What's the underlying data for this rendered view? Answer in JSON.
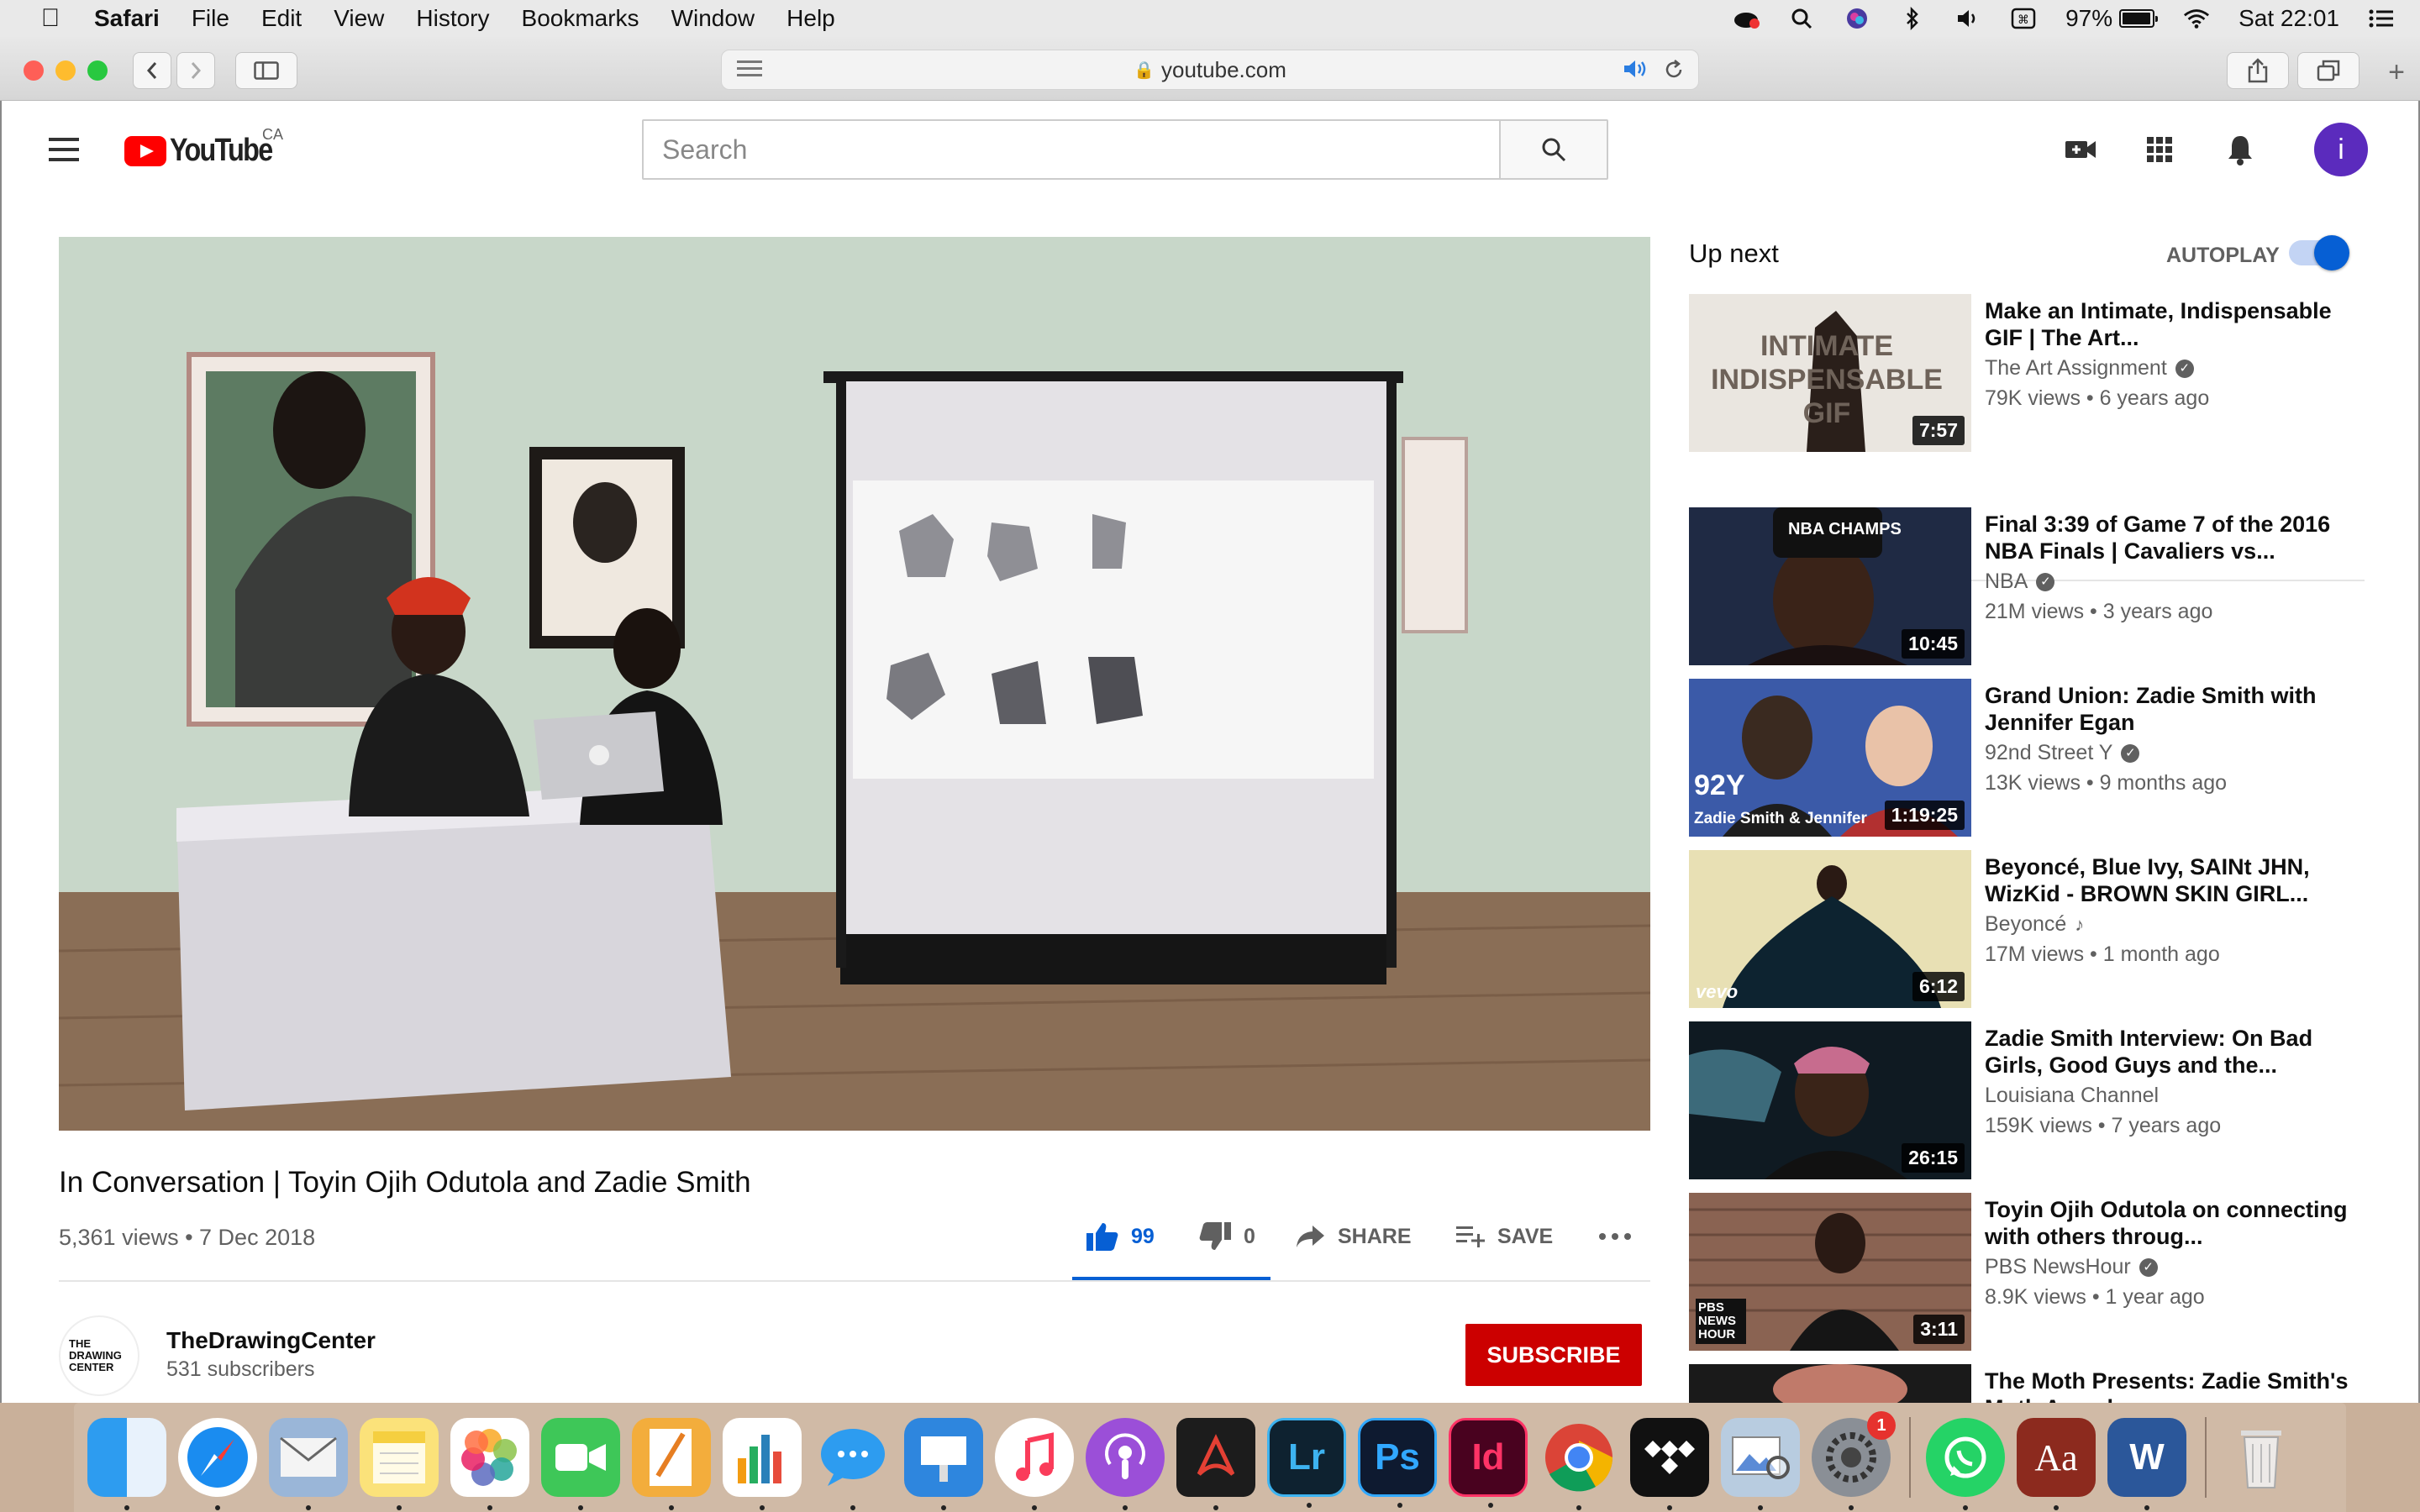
{
  "menubar": {
    "app": "Safari",
    "items": [
      "File",
      "Edit",
      "View",
      "History",
      "Bookmarks",
      "Window",
      "Help"
    ],
    "battery": "97%",
    "clock": "Sat 22:01",
    "battery_level": 0.97
  },
  "browser": {
    "url": "youtube.com"
  },
  "header": {
    "logo_text": "YouTube",
    "country": "CA",
    "search_placeholder": "Search",
    "avatar_letter": "i"
  },
  "video": {
    "title": "In Conversation | Toyin Ojih Odutola and Zadie Smith",
    "meta": "5,361 views • 7 Dec 2018",
    "likes": "99",
    "dislikes": "0",
    "share_label": "SHARE",
    "save_label": "SAVE",
    "channel": "TheDrawingCenter",
    "subscribers": "531 subscribers",
    "subscribe_label": "SUBSCRIBE",
    "channel_logo_text": "THE DRAWING CENTER"
  },
  "sidebar": {
    "up_next": "Up next",
    "autoplay": "AUTOPLAY",
    "autoplay_on": true,
    "items": [
      {
        "title": "Make an Intimate, Indispensable GIF | The Art...",
        "channel": "The Art Assignment",
        "verified": true,
        "stats": "79K views • 6 years ago",
        "duration": "7:57",
        "thumb_text": "INTIMATE INDISPENSABLE GIF"
      },
      {
        "title": "Final 3:39 of Game 7 of the 2016 NBA Finals | Cavaliers vs...",
        "channel": "NBA",
        "verified": true,
        "stats": "21M views • 3 years ago",
        "duration": "10:45",
        "thumb_text": "NBA CHAMPS"
      },
      {
        "title": "Grand Union: Zadie Smith with Jennifer Egan",
        "channel": "92nd Street Y",
        "verified": true,
        "stats": "13K views • 9 months ago",
        "duration": "1:19:25",
        "thumb_text": "92Y",
        "thumb_caption": "Zadie Smith & Jennifer"
      },
      {
        "title": "Beyoncé, Blue Ivy, SAINt JHN, WizKid - BROWN SKIN GIRL...",
        "channel": "Beyoncé",
        "music": true,
        "stats": "17M views • 1 month ago",
        "duration": "6:12",
        "thumb_text": "vevo"
      },
      {
        "title": "Zadie Smith Interview: On Bad Girls, Good Guys and the...",
        "channel": "Louisiana Channel",
        "verified": false,
        "stats": "159K views • 7 years ago",
        "duration": "26:15"
      },
      {
        "title": "Toyin Ojih Odutola on connecting with others throug...",
        "channel": "PBS NewsHour",
        "verified": true,
        "stats": "8.9K views • 1 year ago",
        "duration": "3:11",
        "thumb_text": "PBS NEWS HOUR"
      },
      {
        "title": "The Moth Presents: Zadie Smith's Moth Award...",
        "channel": "",
        "stats": "",
        "duration": ""
      }
    ]
  },
  "dock": {
    "badge_count": "1",
    "apps": [
      "Finder",
      "Safari",
      "Mail",
      "Notes",
      "Photos",
      "FaceTime",
      "Pages",
      "Numbers",
      "Messages",
      "Keynote",
      "Music",
      "Podcasts",
      "Acrobat",
      "Lightroom",
      "Photoshop",
      "InDesign",
      "Chrome",
      "Tidal",
      "Preview",
      "System Preferences",
      "WhatsApp",
      "Dictionary",
      "Word",
      "Trash"
    ],
    "labels": {
      "Lightroom": "Lr",
      "Photoshop": "Ps",
      "InDesign": "Id",
      "Dictionary": "Aa",
      "Word": "W"
    }
  }
}
